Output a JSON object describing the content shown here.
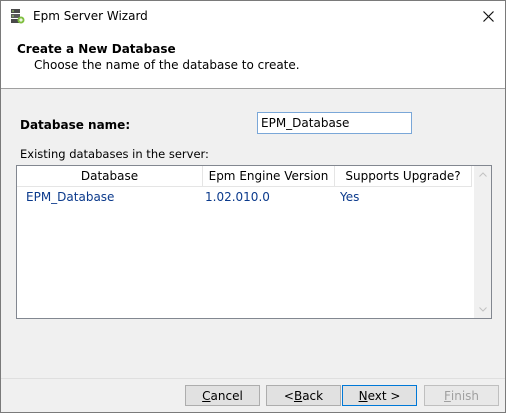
{
  "window": {
    "title": "Epm Server Wizard"
  },
  "header": {
    "title": "Create a New Database",
    "subtitle": "Choose the name of the database to create."
  },
  "form": {
    "dbname_label": "Database name:",
    "dbname_value": "EPM_Database",
    "existing_label": "Existing databases in the server:"
  },
  "table": {
    "columns": [
      "Database",
      "Epm Engine Version",
      "Supports Upgrade?"
    ],
    "rows": [
      [
        "EPM_Database",
        "1.02.010.0",
        "Yes"
      ]
    ]
  },
  "buttons": {
    "cancel": {
      "prefix": "",
      "accel": "C",
      "rest": "ancel"
    },
    "back": {
      "prefix": "< ",
      "accel": "B",
      "rest": "ack"
    },
    "next": {
      "prefix": "",
      "accel": "N",
      "rest": "ext >"
    },
    "finish": {
      "prefix": "",
      "accel": "F",
      "rest": "inish"
    }
  },
  "icons": {
    "app": "server-wizard-icon",
    "close": "close-icon",
    "scroll_up": "chevron-up-icon",
    "scroll_down": "chevron-down-icon"
  },
  "colors": {
    "link_text": "#0b3a8c",
    "default_button_border": "#0078d7"
  }
}
